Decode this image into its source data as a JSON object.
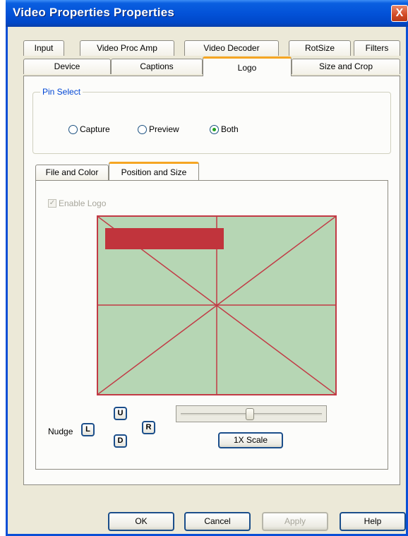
{
  "window": {
    "title": "Video Properties Properties",
    "close_glyph": "X"
  },
  "tabs_row1": [
    {
      "label": "Input"
    },
    {
      "label": "Video Proc Amp"
    },
    {
      "label": "Video Decoder"
    },
    {
      "label": "RotSize"
    },
    {
      "label": "Filters"
    }
  ],
  "tabs_row2": [
    {
      "label": "Device"
    },
    {
      "label": "Captions"
    },
    {
      "label": "Logo"
    },
    {
      "label": "Size and Crop"
    }
  ],
  "pin_select": {
    "label": "Pin Select",
    "options": [
      {
        "label": "Capture",
        "checked": false
      },
      {
        "label": "Preview",
        "checked": false
      },
      {
        "label": "Both",
        "checked": true
      }
    ]
  },
  "sub_tabs": [
    {
      "label": "File and Color"
    },
    {
      "label": "Position and Size"
    }
  ],
  "enable_logo": {
    "label": "Enable Logo",
    "checked": true,
    "disabled": true
  },
  "nudge": {
    "label": "Nudge",
    "up": "U",
    "down": "D",
    "left": "L",
    "right": "R"
  },
  "scale": {
    "button_label": "1X Scale"
  },
  "buttons": {
    "ok": "OK",
    "cancel": "Cancel",
    "apply": "Apply",
    "help": "Help"
  },
  "colors": {
    "accent": "#0046d5",
    "title_bar": "#0352d8",
    "canvas": "#b6d6b4",
    "logo": "#c1343c",
    "active_tab": "#f5a623"
  }
}
